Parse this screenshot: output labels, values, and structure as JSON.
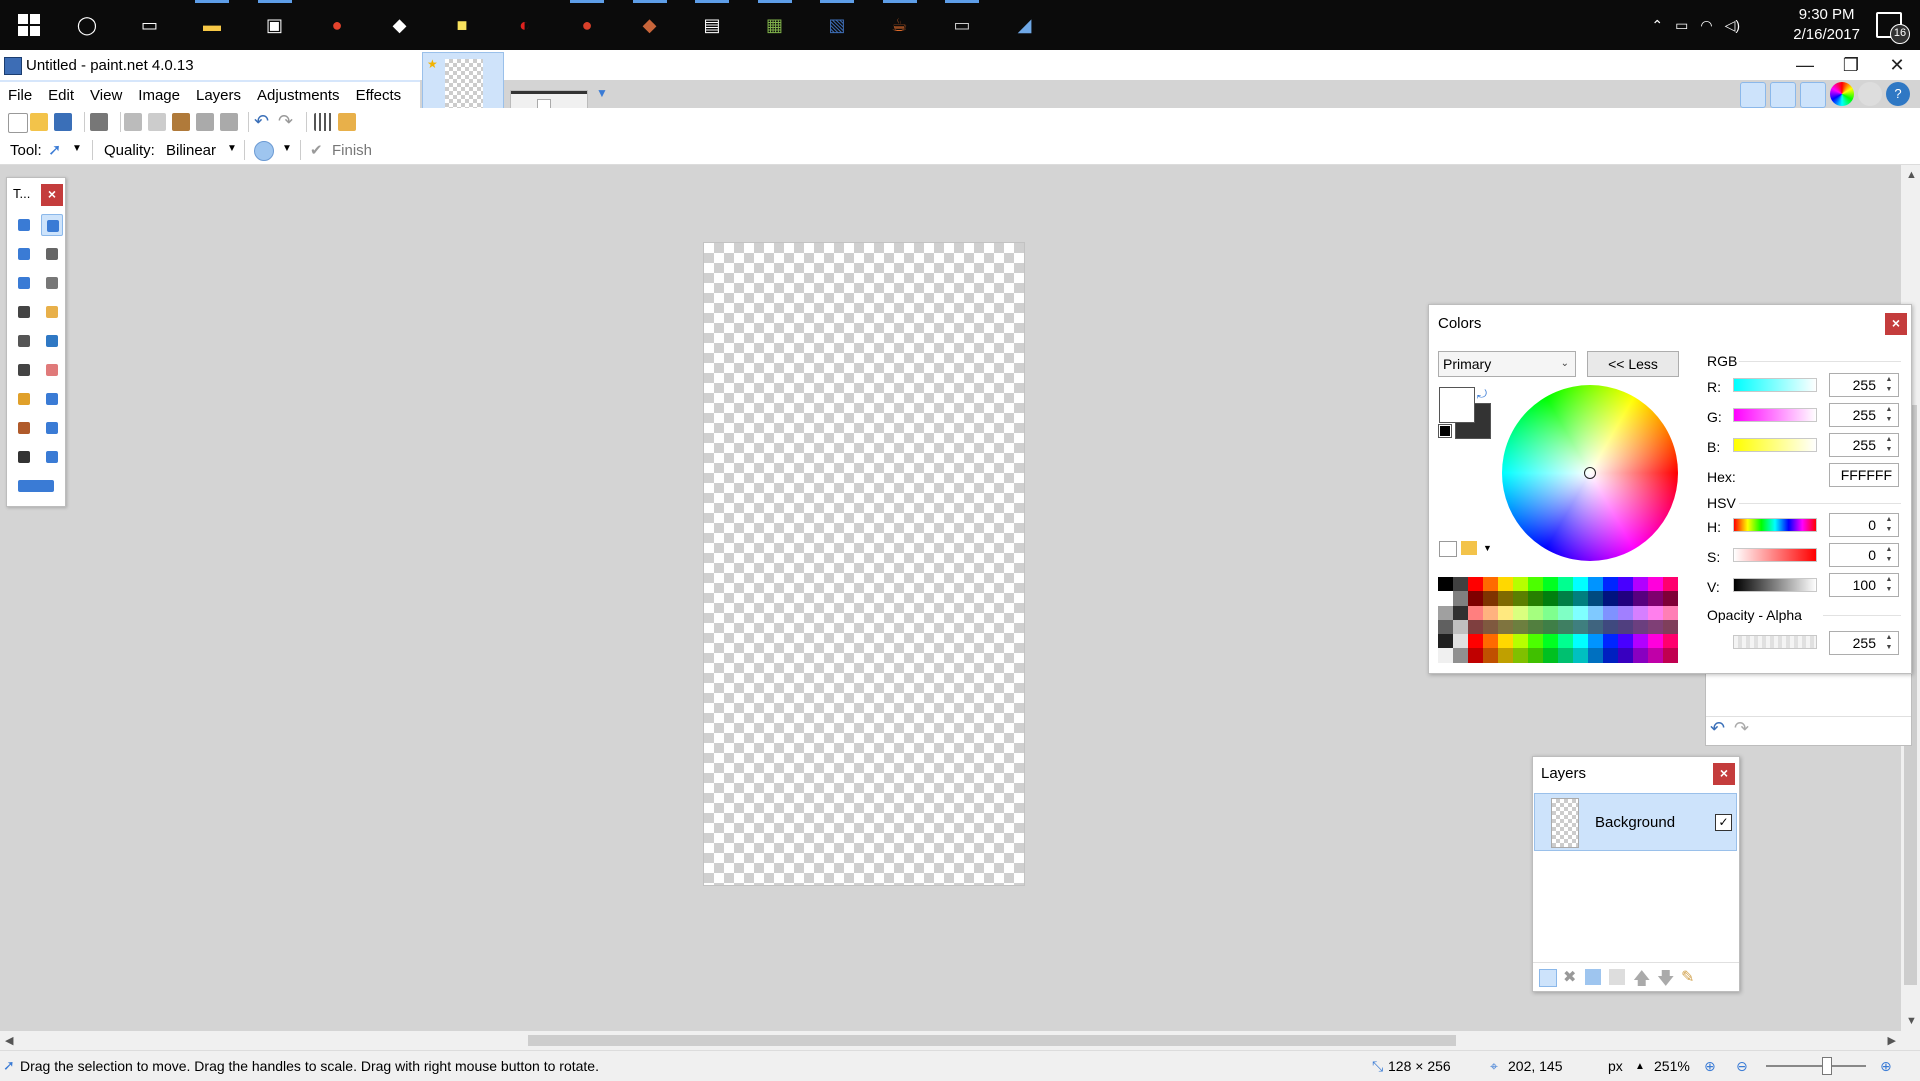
{
  "taskbar": {
    "icons": [
      {
        "name": "cortana-icon",
        "glyph": "◯",
        "color": "#ffffff",
        "active": false
      },
      {
        "name": "task-view-icon",
        "glyph": "▭",
        "color": "#ffffff",
        "active": false
      },
      {
        "name": "file-explorer-icon",
        "glyph": "▬",
        "color": "#f7c846",
        "active": true
      },
      {
        "name": "store-icon",
        "glyph": "▣",
        "color": "#ffffff",
        "active": true
      },
      {
        "name": "chrome-icon",
        "glyph": "●",
        "color": "#e4432d",
        "active": false
      },
      {
        "name": "gamepad-icon",
        "glyph": "◆",
        "color": "#ffffff",
        "active": false
      },
      {
        "name": "sticky-notes-icon",
        "glyph": "■",
        "color": "#f9e25d",
        "active": false
      },
      {
        "name": "smash-icon",
        "glyph": "◐",
        "color": "#e0221f",
        "active": false
      },
      {
        "name": "app-red-icon",
        "glyph": "●",
        "color": "#d9402a",
        "active": true
      },
      {
        "name": "package-icon",
        "glyph": "◆",
        "color": "#c8653a",
        "active": true
      },
      {
        "name": "document-app-icon",
        "glyph": "▤",
        "color": "#ffffff",
        "active": true
      },
      {
        "name": "image-app-icon",
        "glyph": "▦",
        "color": "#7fb04a",
        "active": true
      },
      {
        "name": "paintnet-icon",
        "glyph": "▧",
        "color": "#3d6db5",
        "active": true
      },
      {
        "name": "java-icon",
        "glyph": "☕",
        "color": "#e06b2b",
        "active": true
      },
      {
        "name": "terminal-icon",
        "glyph": "▭",
        "color": "#cccccc",
        "active": true
      },
      {
        "name": "blue-app-icon",
        "glyph": "◢",
        "color": "#6fa8e6",
        "active": false
      }
    ],
    "time": "9:30 PM",
    "date": "2/16/2017",
    "notification_count": "16"
  },
  "window": {
    "title": "Untitled - paint.net 4.0.13",
    "minimize": "—",
    "maximize": "❐",
    "close": "✕"
  },
  "menu": [
    "File",
    "Edit",
    "View",
    "Image",
    "Layers",
    "Adjustments",
    "Effects"
  ],
  "toolbar2": {
    "tool_label": "Tool:",
    "quality_label": "Quality:",
    "quality_value": "Bilinear",
    "finish_label": "Finish"
  },
  "tools_panel": {
    "title": "T...",
    "close": "×",
    "tools": [
      {
        "name": "rectangle-select-icon",
        "color": "#3a7bd5",
        "selected": false
      },
      {
        "name": "move-selection-icon",
        "color": "#3a7bd5",
        "selected": true
      },
      {
        "name": "lasso-select-icon",
        "color": "#3a7bd5",
        "selected": false
      },
      {
        "name": "move-selection-alt-icon",
        "color": "#666666",
        "selected": false
      },
      {
        "name": "ellipse-select-icon",
        "color": "#3a7bd5",
        "selected": false
      },
      {
        "name": "zoom-icon",
        "color": "#777777",
        "selected": false
      },
      {
        "name": "magic-wand-icon",
        "color": "#444444",
        "selected": false
      },
      {
        "name": "pan-icon",
        "color": "#e8b04a",
        "selected": false
      },
      {
        "name": "paint-bucket-icon",
        "color": "#555555",
        "selected": false
      },
      {
        "name": "gradient-icon",
        "color": "#2f78c4",
        "selected": false
      },
      {
        "name": "paintbrush-icon",
        "color": "#444444",
        "selected": false
      },
      {
        "name": "eraser-icon",
        "color": "#e07a7a",
        "selected": false
      },
      {
        "name": "pencil-icon",
        "color": "#e0a02a",
        "selected": false
      },
      {
        "name": "color-picker-icon",
        "color": "#3a7bd5",
        "selected": false
      },
      {
        "name": "clone-stamp-icon",
        "color": "#b05a2a",
        "selected": false
      },
      {
        "name": "recolor-icon",
        "color": "#3a7bd5",
        "selected": false
      },
      {
        "name": "text-icon",
        "color": "#333333",
        "selected": false
      },
      {
        "name": "line-curve-icon",
        "color": "#3a7bd5",
        "selected": false
      },
      {
        "name": "shapes-icon",
        "color": "#3a7bd5",
        "selected": false
      }
    ]
  },
  "colors_panel": {
    "title": "Colors",
    "close": "×",
    "mode": "Primary",
    "less_button": "<< Less",
    "rgb_label": "RGB",
    "r_label": "R:",
    "r_value": "255",
    "g_label": "G:",
    "g_value": "255",
    "b_label": "B:",
    "b_value": "255",
    "hex_label": "Hex:",
    "hex_value": "FFFFFF",
    "hsv_label": "HSV",
    "h_label": "H:",
    "h_value": "0",
    "s_label": "S:",
    "s_value": "0",
    "v_label": "V:",
    "v_value": "100",
    "opacity_label": "Opacity - Alpha",
    "alpha_value": "255",
    "primary_color": "#ffffff",
    "secondary_color": "#333333",
    "palette_rows": [
      [
        "#000000",
        "#404040",
        "#ff0000",
        "#ff6a00",
        "#ffd800",
        "#b6ff00",
        "#4cff00",
        "#00ff21",
        "#00ff90",
        "#00ffff",
        "#0094ff",
        "#0026ff",
        "#4800ff",
        "#b200ff",
        "#ff00dc",
        "#ff006e"
      ],
      [
        "#ffffff",
        "#808080",
        "#7f0000",
        "#7f3300",
        "#7f6a00",
        "#5b7f00",
        "#267f00",
        "#007f0e",
        "#007f46",
        "#007f7f",
        "#004a7f",
        "#00137f",
        "#21007f",
        "#57007f",
        "#7f006e",
        "#7f0037"
      ],
      [
        "#a0a0a0",
        "#303030",
        "#ff7f7f",
        "#ffb27f",
        "#ffe97f",
        "#daff7f",
        "#a5ff7f",
        "#7fff8e",
        "#7fffc5",
        "#7fffff",
        "#7fc9ff",
        "#7f92ff",
        "#a17fff",
        "#d67fff",
        "#ff7fed",
        "#ff7fb6"
      ],
      [
        "#606060",
        "#c0c0c0",
        "#7f3f3f",
        "#7f593f",
        "#7f743f",
        "#6d7f3f",
        "#527f3f",
        "#3f7f47",
        "#3f7f62",
        "#3f7f7f",
        "#3f647f",
        "#3f497f",
        "#503f7f",
        "#6b3f7f",
        "#7f3f76",
        "#7f3f5b"
      ],
      [
        "#202020",
        "#e0e0e0",
        "#ff0000",
        "#ff6a00",
        "#ffd800",
        "#b6ff00",
        "#4cff00",
        "#00ff21",
        "#00ff90",
        "#00ffff",
        "#0094ff",
        "#0026ff",
        "#4800ff",
        "#b200ff",
        "#ff00dc",
        "#ff006e"
      ],
      [
        "#f0f0f0",
        "#909090",
        "#c00000",
        "#c05000",
        "#c0a000",
        "#80c000",
        "#40c000",
        "#00c020",
        "#00c070",
        "#00c0c0",
        "#0070c0",
        "#0020c0",
        "#3800c0",
        "#8800c0",
        "#c000a8",
        "#c00050"
      ]
    ]
  },
  "layers_panel": {
    "title": "Layers",
    "close": "×",
    "layer_name": "Background",
    "layer_visible": "✓"
  },
  "statusbar": {
    "message": "Drag the selection to move. Drag the handles to scale. Drag with right mouse button to rotate.",
    "size": "128 × 256",
    "cursor": "202, 145",
    "units": "px",
    "zoom": "251%"
  }
}
